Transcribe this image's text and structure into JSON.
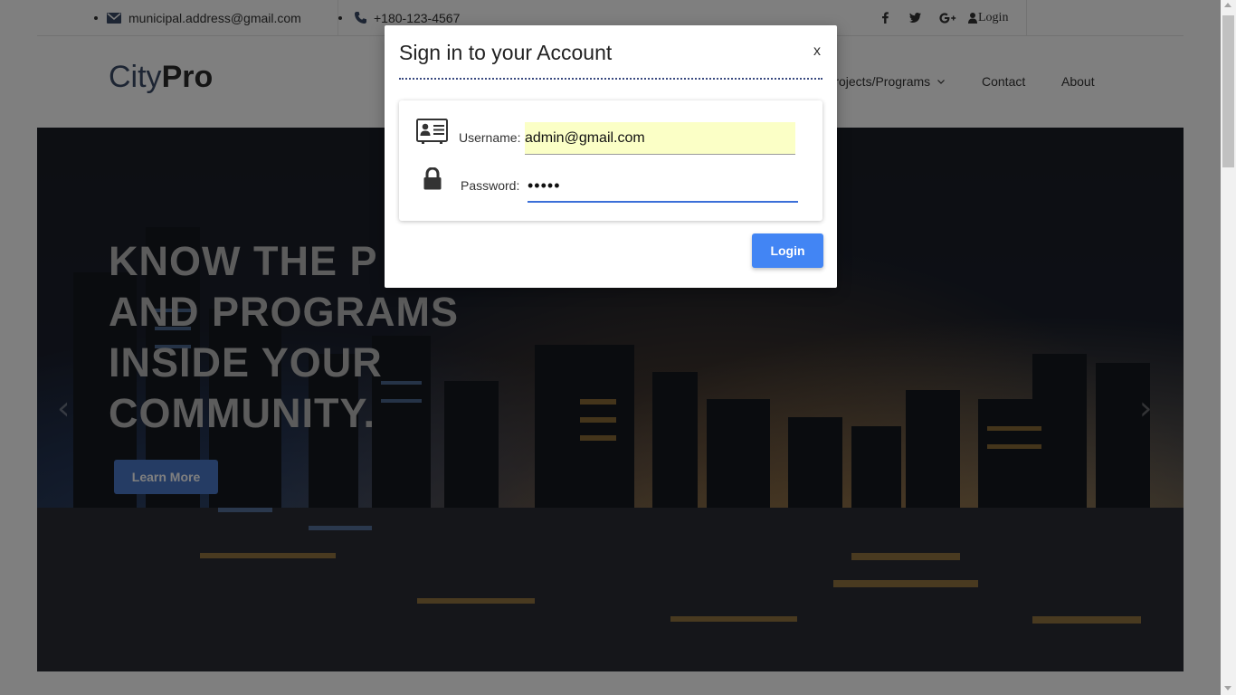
{
  "topbar": {
    "email": "municipal.address@gmail.com",
    "phone": "+180-123-4567",
    "login_label": "Login"
  },
  "icons": {
    "email": "envelope-icon",
    "phone": "phone-icon",
    "facebook": "facebook-icon",
    "twitter": "twitter-icon",
    "google_plus": "google-plus-icon",
    "user": "user-icon",
    "id_card": "id-card-icon",
    "lock": "lock-icon"
  },
  "brand": {
    "light": "City",
    "bold": "Pro"
  },
  "nav": {
    "projects": "Projects/Programs",
    "contact": "Contact",
    "about": "About"
  },
  "hero": {
    "line1": "KNOW THE P",
    "line2": "AND PROGRAMS",
    "line3": "INSIDE YOUR",
    "line4": "COMMUNITY.",
    "button": "Learn More",
    "prev": "‹",
    "next": "›"
  },
  "modal": {
    "title": "Sign in to your Account",
    "close": "x",
    "username_label": "Username:",
    "username_value": "admin@gmail.com",
    "password_label": "Password:",
    "password_value": "•••••",
    "login_button": "Login"
  },
  "colors": {
    "accent": "#4285f4",
    "autofill": "#fbffc6",
    "hero_button": "#4a78c9"
  }
}
